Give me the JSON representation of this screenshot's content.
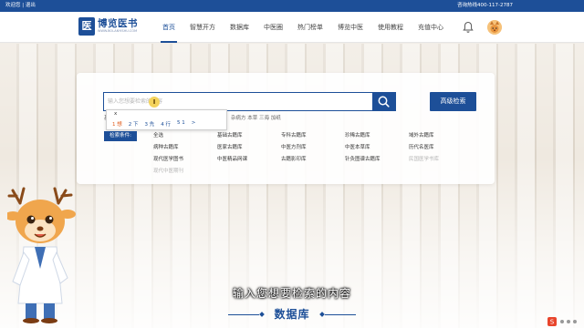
{
  "topbar": {
    "welcome": "欢迎您 | 退出",
    "hotline": "咨询热线400-117-2787"
  },
  "logo": {
    "mark": "医",
    "name": "博览医书",
    "sub": "WWW.BOLANYISHU.COM"
  },
  "nav": {
    "items": [
      "首页",
      "智慧开方",
      "数据库",
      "中医圈",
      "热门榜单",
      "博览中医",
      "使用教程",
      "充值中心"
    ],
    "active_index": 0
  },
  "search": {
    "value": "",
    "placeholder": "输入您想要检索的内容",
    "advanced_label": "高级检索"
  },
  "ime": {
    "pinyin": "x",
    "candidates": [
      "1 想",
      "2 下",
      "3 先",
      "4 行",
      "5 1",
      ">"
    ]
  },
  "hint": {
    "prefix": "基",
    "right": "杂病方  本草  三海  加纸"
  },
  "filter": {
    "label": "检索条件:",
    "items": [
      {
        "text": "全选",
        "muted": false
      },
      {
        "text": "基础古籍库",
        "muted": false
      },
      {
        "text": "专科古籍库",
        "muted": false
      },
      {
        "text": "珍稀古籍库",
        "muted": false
      },
      {
        "text": "域外古籍库",
        "muted": false
      },
      {
        "text": "病种古籍库",
        "muted": false
      },
      {
        "text": "医家古籍库",
        "muted": false
      },
      {
        "text": "中医方剂库",
        "muted": false
      },
      {
        "text": "中医本草库",
        "muted": false
      },
      {
        "text": "历代名医库",
        "muted": false
      },
      {
        "text": "现代医学图书",
        "muted": false
      },
      {
        "text": "中医精品网课",
        "muted": false
      },
      {
        "text": "古籍影印库",
        "muted": false
      },
      {
        "text": "针灸图谱古籍库",
        "muted": false
      },
      {
        "text": "民国医学书库",
        "muted": true
      },
      {
        "text": "现代中医期刊",
        "muted": true
      }
    ]
  },
  "subtitle": "输入您想要检索的内容",
  "section_tag": "数据库",
  "colors": {
    "brand": "#1d4f98",
    "bg": "#f1ede7"
  }
}
